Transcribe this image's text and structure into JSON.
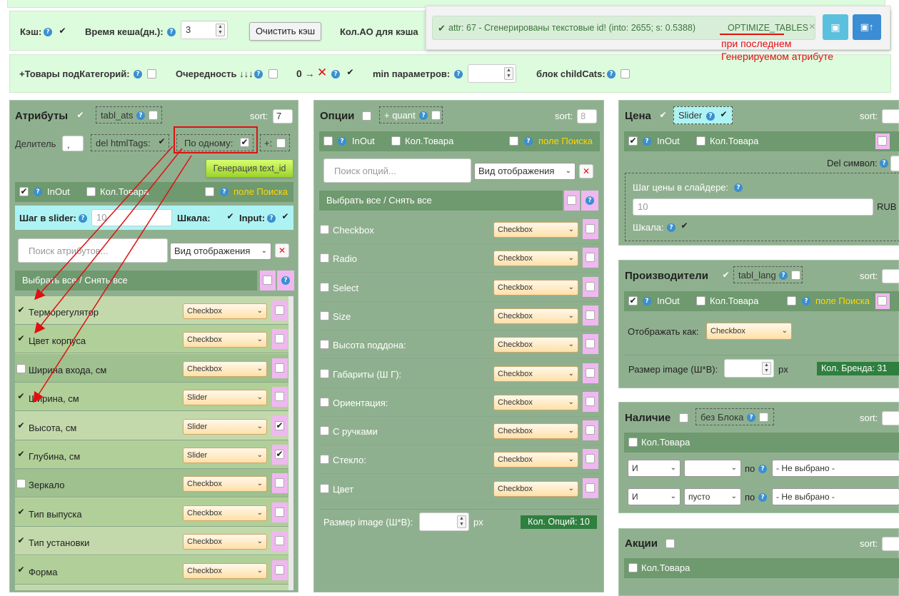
{
  "top": {
    "cache_label": "Кэш:",
    "cache_time_label": "Время кеша(дн.):",
    "cache_time_value": "3",
    "clear_cache_button": "Очистить кэш",
    "ao_count_label": "Кол.АО для кэша",
    "subcat_label": "+Товары подКатегорий:",
    "order_label": "Очередность ↓↓↓",
    "zero_label": "0 →",
    "min_params_label": "min параметров:",
    "childcats_label": "блок childCats:"
  },
  "notification": {
    "text": "attr: 67 - Сгенерированы текстовые id! (into: 2655; s: 0.5388)",
    "link": "OPTIMIZE_TABLES",
    "close": "×",
    "annotation_line1": "при последнем",
    "annotation_line2": "Генерируемом атрибуте"
  },
  "attributes": {
    "title": "Атрибуты",
    "table_tag": "tabl_ats",
    "sort_label": "sort:",
    "sort_value": "7",
    "divider_label": "Делитель",
    "divider_value": ",",
    "del_html_label": "del htmlTags:",
    "one_by_one_label": "По одному:",
    "plus_label": "+:",
    "generate_button": "Генерация text_id",
    "inout_label": "InOut",
    "qty_label": "Кол.Товара",
    "search_field_label": "поле Поиска",
    "slider_step_label": "Шаг в slider:",
    "slider_step_value": "10",
    "scale_label": "Шкала:",
    "input_label": "Input:",
    "search_placeholder": "Поиск атрибутов...",
    "view_select": "Вид отображения",
    "select_all": "Выбрать все  /  Снять все",
    "items": [
      {
        "name": "Терморегулятор",
        "checked": true,
        "type": "Checkbox",
        "right": false
      },
      {
        "name": "Цвет корпуса",
        "checked": true,
        "type": "Checkbox",
        "right": false
      },
      {
        "name": "Ширина входа, см",
        "checked": false,
        "type": "Checkbox",
        "right": false
      },
      {
        "name": "Ширина, см",
        "checked": true,
        "type": "Slider",
        "right": false
      },
      {
        "name": "Высота, см",
        "checked": true,
        "type": "Slider",
        "right": true
      },
      {
        "name": "Глубина, см",
        "checked": true,
        "type": "Slider",
        "right": true
      },
      {
        "name": "Зеркало",
        "checked": false,
        "type": "Checkbox",
        "right": false
      },
      {
        "name": "Тип выпуска",
        "checked": true,
        "type": "Checkbox",
        "right": false
      },
      {
        "name": "Тип установки",
        "checked": true,
        "type": "Checkbox",
        "right": false
      },
      {
        "name": "Форма",
        "checked": true,
        "type": "Checkbox",
        "right": false
      }
    ]
  },
  "options": {
    "title": "Опции",
    "quant_tag": "+ quant",
    "sort_label": "sort:",
    "sort_value": "8",
    "inout_label": "InOut",
    "qty_label": "Кол.Товара",
    "search_field_label": "поле Поиска",
    "search_placeholder": "Поиск опций...",
    "view_select": "Вид отображения",
    "select_all": "Выбрать все  /  Снять все",
    "items": [
      {
        "name": "Checkbox",
        "type": "Checkbox"
      },
      {
        "name": "Radio",
        "type": "Checkbox"
      },
      {
        "name": "Select",
        "type": "Checkbox"
      },
      {
        "name": "Size",
        "type": "Checkbox"
      },
      {
        "name": "Высота поддона:",
        "type": "Checkbox"
      },
      {
        "name": "Габариты (Ш Г):",
        "type": "Checkbox"
      },
      {
        "name": "Ориентация:",
        "type": "Checkbox"
      },
      {
        "name": "С ручками",
        "type": "Checkbox"
      },
      {
        "name": "Стекло:",
        "type": "Checkbox"
      },
      {
        "name": "Цвет",
        "type": "Checkbox"
      }
    ],
    "image_size_label": "Размер image (Ш*В):",
    "px": "px",
    "options_count": "Кол. Опций: 10"
  },
  "price": {
    "title": "Цена",
    "slider_tag": "Slider",
    "sort_label": "sort:",
    "inout_label": "InOut",
    "qty_label": "Кол.Товара",
    "del_symbol_label": "Del символ:",
    "step_label": "Шаг цены в слайдере:",
    "step_value": "10",
    "currency": "RUB",
    "scale_label": "Шкала:"
  },
  "manufacturers": {
    "title": "Производители",
    "tag": "tabl_lang",
    "sort_label": "sort:",
    "inout_label": "InOut",
    "qty_label": "Кол.Товара",
    "search_field_label": "поле Поиска",
    "display_as_label": "Отображать как:",
    "display_as_value": "Checkbox",
    "image_size_label": "Размер image (Ш*В):",
    "px": "px",
    "brand_count": "Кол. Бренда: 31"
  },
  "availability": {
    "title": "Наличие",
    "no_block_tag": "без Блока",
    "sort_label": "sort:",
    "qty_label": "Кол.Товара",
    "row1": {
      "op": "И",
      "value": "",
      "by": "по",
      "select": "- Не выбрано -"
    },
    "row2": {
      "op": "И",
      "value": "пусто",
      "by": "по",
      "select": "- Не выбрано -"
    }
  },
  "promotions": {
    "title": "Акции",
    "sort_label": "sort:",
    "qty_label": "Кол.Товара"
  },
  "colors": {
    "panel": "#8fb08f",
    "section": "#6f996f",
    "band": "#ddfbdd",
    "accent_red": "#e01010",
    "save_blue": "#5bc0de"
  }
}
